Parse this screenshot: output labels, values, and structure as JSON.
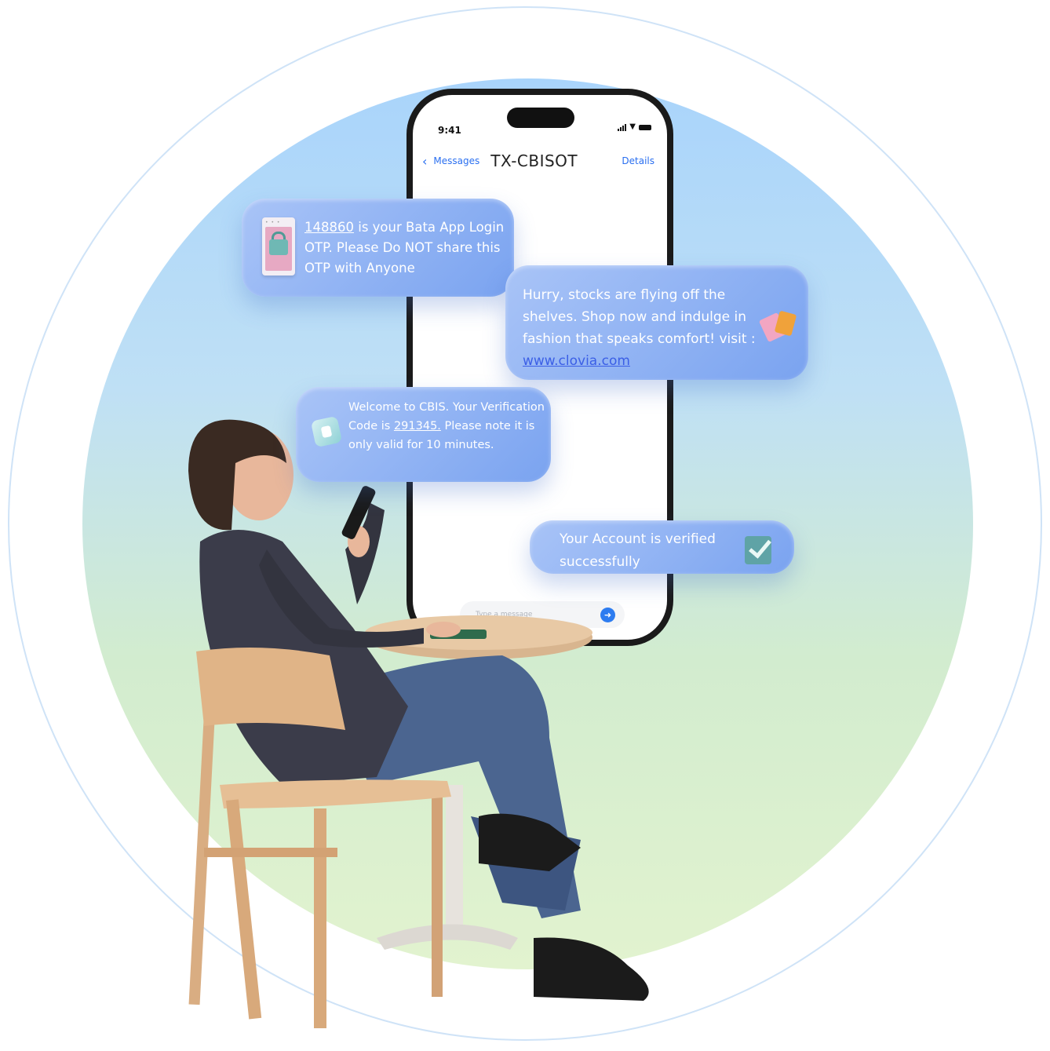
{
  "phone": {
    "status_time": "9:41",
    "nav_back_label": "Messages",
    "sender": "TX-CBISOT",
    "details_label": "Details",
    "input_placeholder": "Type a message"
  },
  "messages": [
    {
      "otp": "148860",
      "text": " is your Bata App Login OTP. Please Do NOT share this OTP with Anyone"
    },
    {
      "text": "Hurry, stocks are flying off the shelves. Shop now and indulge in fashion that speaks comfort! visit : ",
      "link": "www.clovia.com"
    },
    {
      "text_before": "Welcome to CBIS. Your Verification Code is ",
      "code": "291345.",
      "text_after": " Please note it is only valid for 10 minutes."
    },
    {
      "text": "Your Account is verified successfully"
    }
  ],
  "colors": {
    "accent": "#2a6ff0",
    "bubble": "#8fb0f3"
  }
}
